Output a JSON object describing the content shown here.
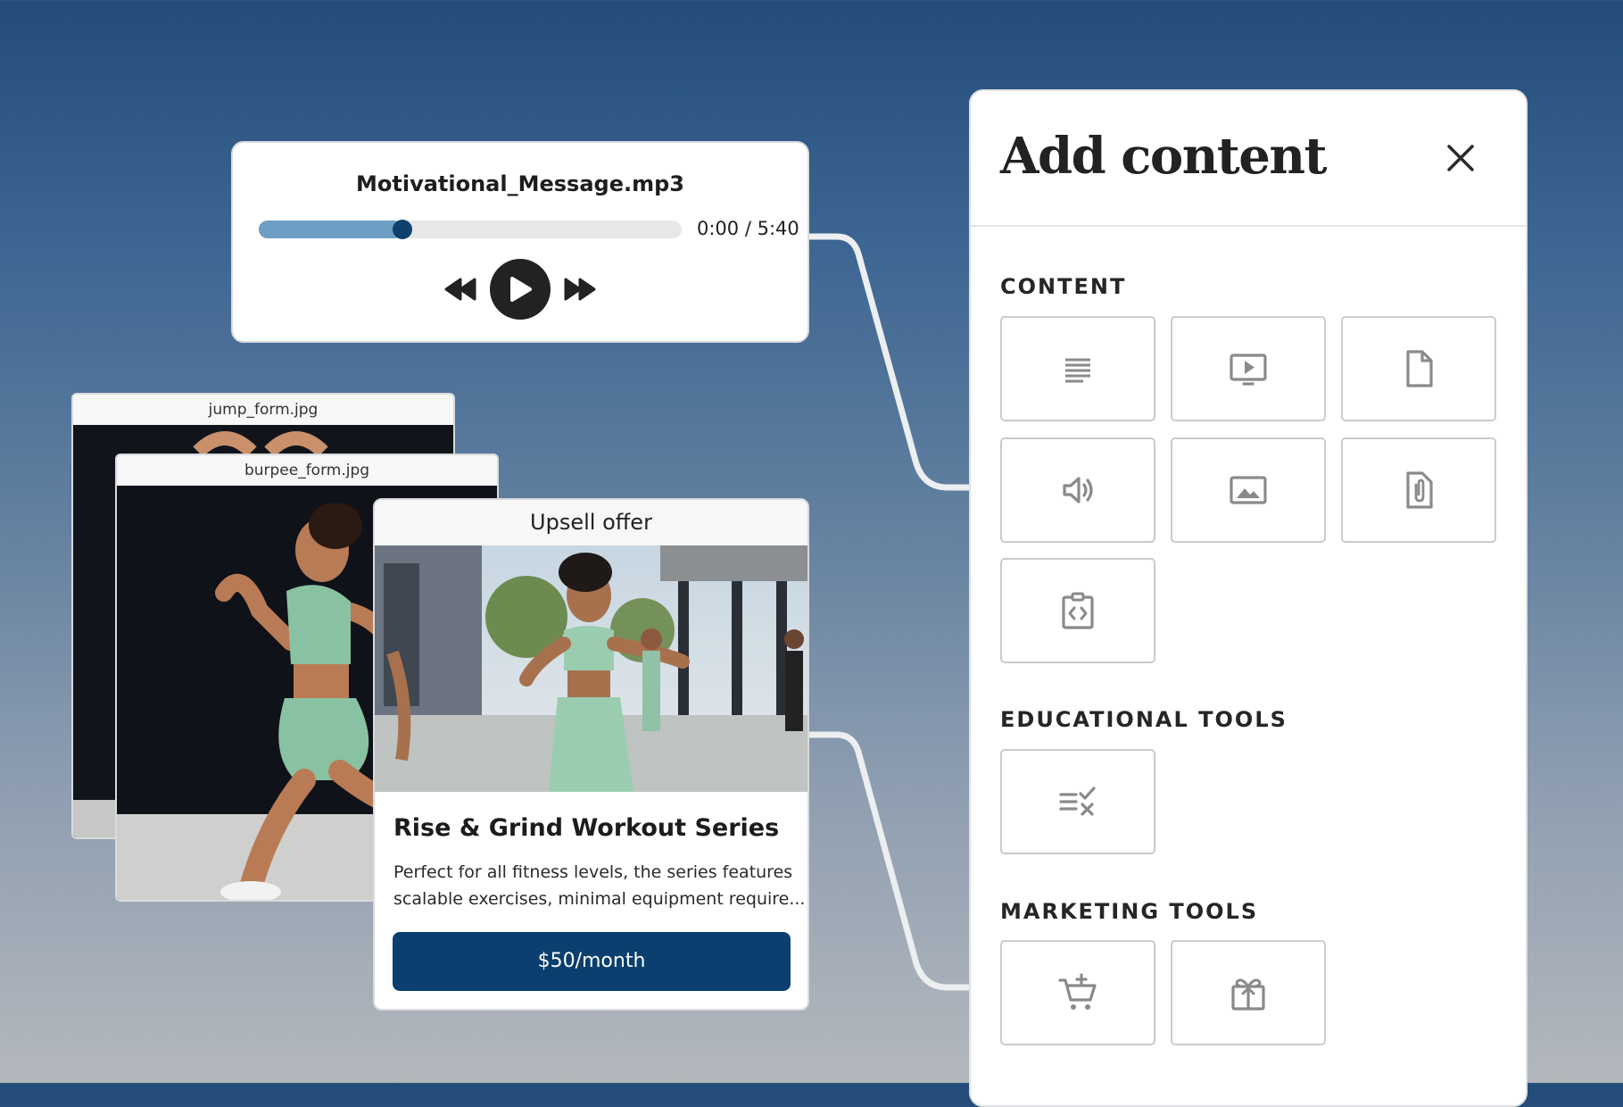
{
  "audio_player": {
    "file_name": "Motivational_Message.mp3",
    "time_readout": "0:00 / 5:40",
    "progress_fraction": 0.34,
    "accent_color": "#0f416e",
    "fill_color": "#6f9ec4"
  },
  "images": [
    {
      "file_name": "jump_form.jpg"
    },
    {
      "file_name": "burpee_form.jpg"
    }
  ],
  "upsell": {
    "header": "Upsell offer",
    "title": "Rise & Grind Workout Series",
    "description_line1": "Perfect for all fitness levels, the series features",
    "description_line2": "scalable exercises, minimal equipment require...",
    "price_label": "$50/month",
    "button_color": "#0b3f6f"
  },
  "panel": {
    "title": "Add content",
    "close_icon": "close-icon",
    "sections": {
      "content": {
        "label": "CONTENT",
        "items": [
          "text-icon",
          "video-icon",
          "document-icon",
          "audio-icon",
          "image-icon",
          "attachment-icon",
          "embed-code-icon"
        ]
      },
      "educational": {
        "label": "EDUCATIONAL TOOLS",
        "items": [
          "quiz-icon"
        ]
      },
      "marketing": {
        "label": "MARKETING TOOLS",
        "items": [
          "add-to-cart-icon",
          "gift-icon"
        ]
      }
    }
  }
}
